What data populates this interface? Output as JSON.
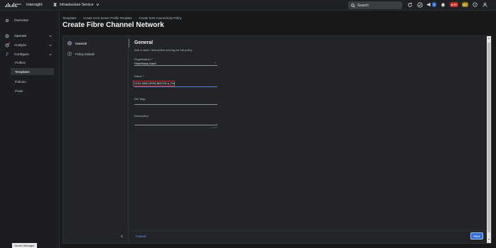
{
  "topbar": {
    "app_name": "Intersight",
    "service_label": "Infrastructure Service",
    "search_placeholder": "Search",
    "task_count": "3",
    "alarm_red_count": "95",
    "alarm_yellow_count": "3"
  },
  "sidebar": {
    "overview": "Overview",
    "operate": "Operate",
    "analyze": "Analyze",
    "configure": "Configure",
    "sub_items": [
      "Profiles",
      "Templates",
      "Policies",
      "Pools"
    ],
    "tooltip": "Server Manager"
  },
  "breadcrumb": [
    "Templates",
    "Create UCS Server Profile Template",
    "Create SAN Connectivity Policy"
  ],
  "page_title": "Create Fibre Channel Network",
  "steps": [
    {
      "num": "1",
      "label": "General"
    },
    {
      "num": "2",
      "label": "Policy Details"
    }
  ],
  "form": {
    "title": "General",
    "subtitle": "Add a name, description and tag for the policy.",
    "org_label": "Organization *",
    "org_value": "FlashStack-SaaS",
    "name_label": "Name *",
    "name_value": "C1S1-DM2-OFNS-BDCCN-A_Pol",
    "tags_label": "Set Tags",
    "desc_label": "Description",
    "desc_counter": "0/1024"
  },
  "footer": {
    "cancel": "Cancel",
    "next": "Next"
  },
  "colors": {
    "accent": "#2f6fd0",
    "highlight_box": "#e0242b"
  }
}
